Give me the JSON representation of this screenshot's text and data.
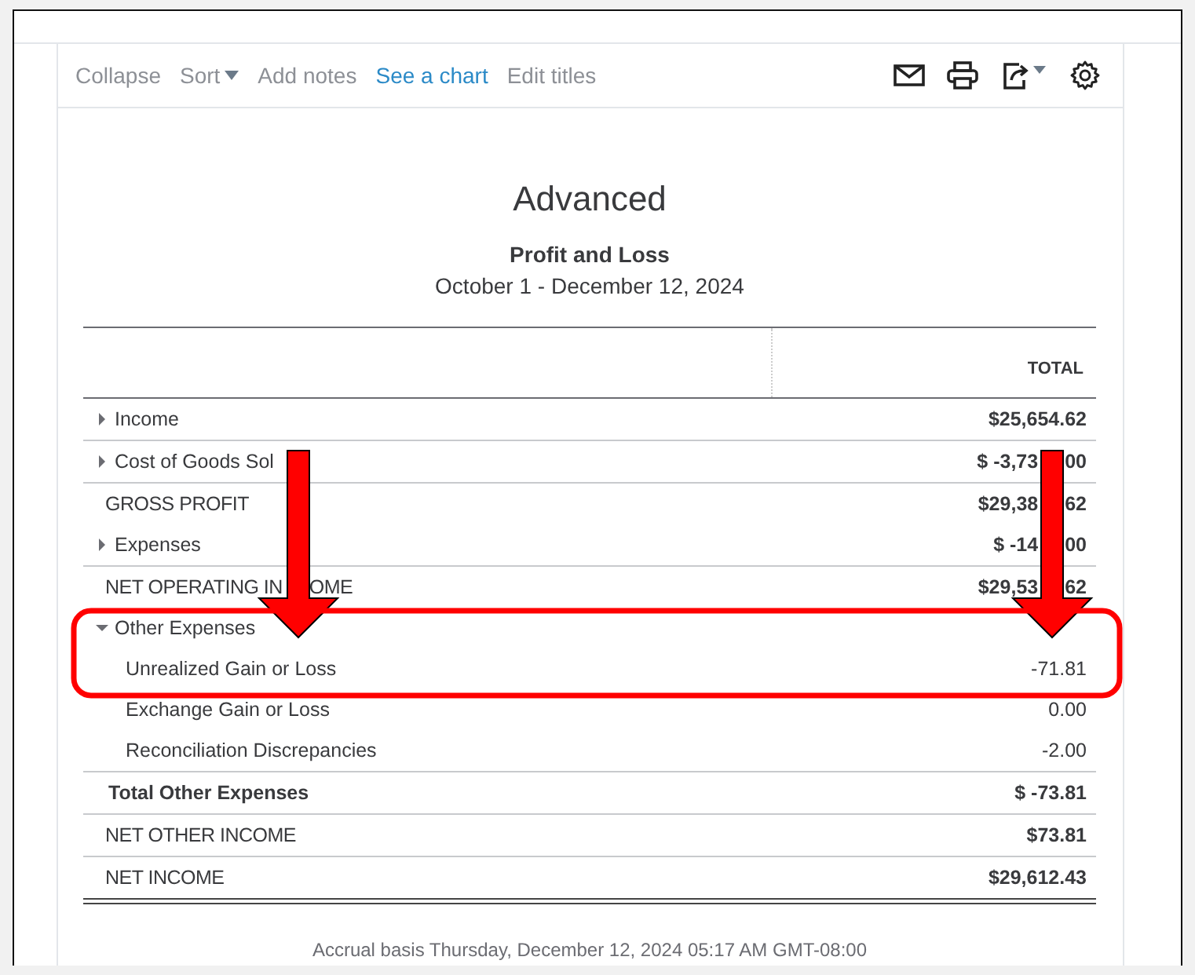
{
  "toolbar": {
    "actions": [
      {
        "label": "Collapse",
        "kind": "plain"
      },
      {
        "label": "Sort",
        "kind": "menu"
      },
      {
        "label": "Add notes",
        "kind": "plain"
      },
      {
        "label": "See a chart",
        "kind": "link"
      },
      {
        "label": "Edit titles",
        "kind": "plain"
      }
    ]
  },
  "report": {
    "company": "Advanced",
    "title": "Profit and Loss",
    "period": "October 1 - December 12, 2024",
    "column_header": "TOTAL",
    "rows": [
      {
        "label": "Income",
        "amount": "$25,654.62",
        "kind": "group",
        "expanded": false,
        "rule_below": true
      },
      {
        "label": "Cost of Goods Sol",
        "amount": "$ -3,73",
        "amount_after_arrow": "00",
        "kind": "group",
        "expanded": false,
        "rule_below": true
      },
      {
        "label": "GROSS PROFIT",
        "amount": "$29,38",
        "amount_after_arrow": "62",
        "kind": "summary",
        "rule_below": false
      },
      {
        "label": "Expenses",
        "amount": "$ -14",
        "amount_after_arrow": "00",
        "kind": "group",
        "expanded": false,
        "rule_below": true
      },
      {
        "label": "NET OPERATING IN",
        "label_after_arrow": "OME",
        "amount": "$29,53",
        "amount_after_arrow": "62",
        "kind": "summary",
        "rule_below": false
      },
      {
        "label": "Other Expenses",
        "kind": "group",
        "expanded": true,
        "rule_below": false
      },
      {
        "label": "Unrealized Gain or Loss",
        "amount": "-71.81",
        "kind": "child",
        "rule_below": false
      },
      {
        "label": "Exchange Gain or Loss",
        "amount": "0.00",
        "kind": "child",
        "rule_below": false
      },
      {
        "label": "Reconciliation Discrepancies",
        "amount": "-2.00",
        "kind": "child",
        "rule_below": true
      },
      {
        "label": "Total Other Expenses",
        "amount": "$ -73.81",
        "kind": "total",
        "rule_below": true
      },
      {
        "label": "NET OTHER INCOME",
        "amount": "$73.81",
        "kind": "summary",
        "rule_below": true
      },
      {
        "label": "NET INCOME",
        "amount": "$29,612.43",
        "kind": "summary",
        "rule_below": false
      }
    ],
    "footer": "Accrual basis Thursday, December 12, 2024 05:17 AM GMT-08:00"
  }
}
